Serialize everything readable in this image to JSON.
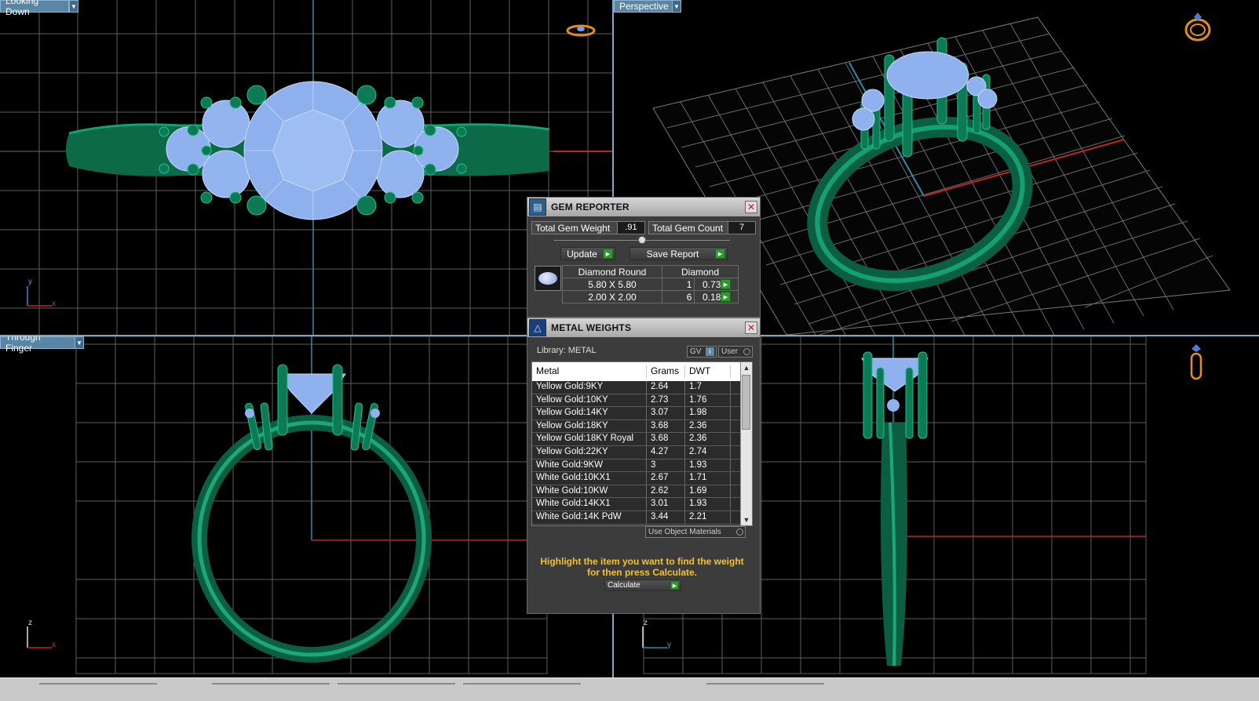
{
  "viewports": {
    "top_left": {
      "label": "Looking Down",
      "axis_v": "y",
      "axis_h": "x"
    },
    "top_right": {
      "label": "Perspective"
    },
    "bottom_left": {
      "label": "Through Finger",
      "axis_v": "z",
      "axis_h": "x"
    },
    "bottom_right": {
      "axis_v": "z",
      "axis_h": "y"
    }
  },
  "colors": {
    "metal": "#0e7a55",
    "gem": "#8fb2ee",
    "grid": "#6b6b6b",
    "axis_red": "#c0261c",
    "axis_cyan": "#2e8aa7"
  },
  "gem_reporter": {
    "title": "GEM REPORTER",
    "total_weight_label": "Total Gem Weight",
    "total_weight_value": ".91",
    "total_count_label": "Total Gem Count",
    "total_count_value": "7",
    "update_label": "Update",
    "save_report_label": "Save Report",
    "table": {
      "header": [
        "Diamond Round",
        "Diamond"
      ],
      "rows": [
        {
          "size": "5.80 X 5.80",
          "count": "1",
          "weight": "0.73tw"
        },
        {
          "size": "2.00 X 2.00",
          "count": "6",
          "weight": "0.18tw"
        }
      ]
    }
  },
  "metal_weights": {
    "title": "METAL WEIGHTS",
    "library_label": "Library: METAL",
    "gv_label": "GV",
    "user_label": "User",
    "columns": [
      "Metal",
      "Grams",
      "DWT"
    ],
    "rows": [
      {
        "metal": "Yellow Gold:9KY",
        "grams": "2.64",
        "dwt": "1.7"
      },
      {
        "metal": "Yellow Gold:10KY",
        "grams": "2.73",
        "dwt": "1.76"
      },
      {
        "metal": "Yellow Gold:14KY",
        "grams": "3.07",
        "dwt": "1.98"
      },
      {
        "metal": "Yellow Gold:18KY",
        "grams": "3.68",
        "dwt": "2.36"
      },
      {
        "metal": "Yellow Gold:18KY Royal",
        "grams": "3.68",
        "dwt": "2.36"
      },
      {
        "metal": "Yellow Gold:22KY",
        "grams": "4.27",
        "dwt": "2.74"
      },
      {
        "metal": "White Gold:9KW",
        "grams": "3",
        "dwt": "1.93"
      },
      {
        "metal": "White Gold:10KX1",
        "grams": "2.67",
        "dwt": "1.71"
      },
      {
        "metal": "White Gold:10KW",
        "grams": "2.62",
        "dwt": "1.69"
      },
      {
        "metal": "White Gold:14KX1",
        "grams": "3.01",
        "dwt": "1.93"
      },
      {
        "metal": "White Gold:14K PdW",
        "grams": "3.44",
        "dwt": "2.21"
      }
    ],
    "use_object_materials_label": "Use Object Materials",
    "hint": "Highlight the item you want to find the weight for then press Calculate.",
    "calculate_label": "Calculate"
  }
}
